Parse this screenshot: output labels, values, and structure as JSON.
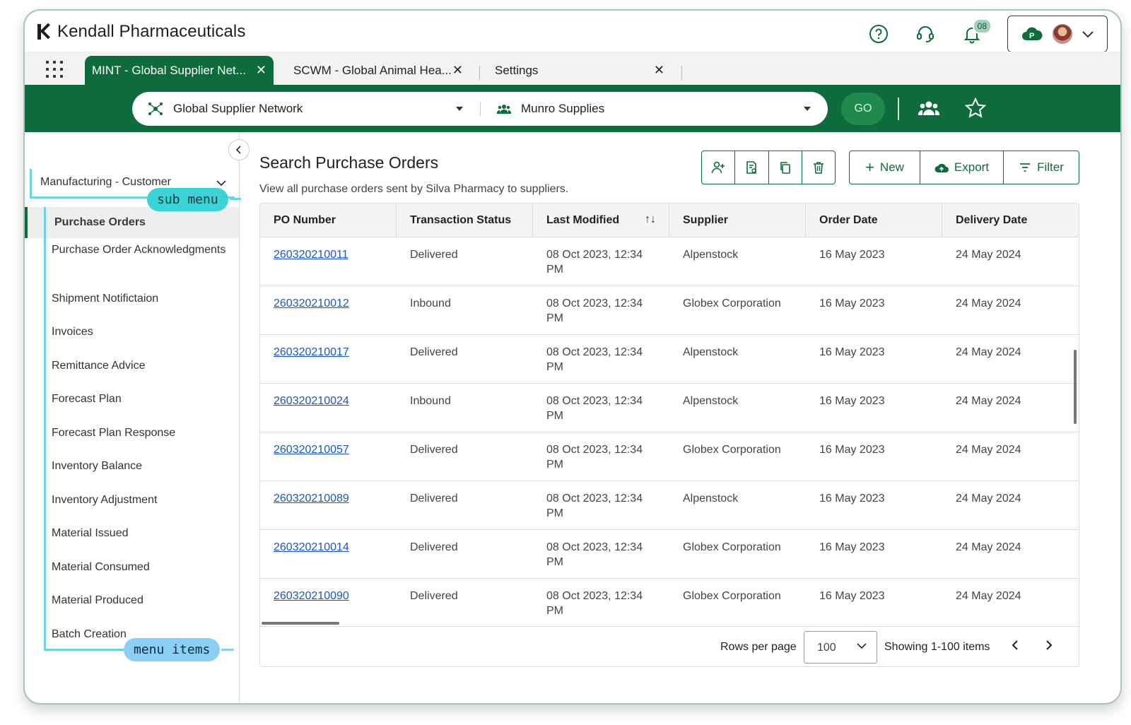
{
  "brand": {
    "name": "Kendall Pharmaceuticals"
  },
  "header": {
    "notification_count": "08",
    "icons": [
      "help-icon",
      "support-headset-icon",
      "bell-icon",
      "cloud-p-icon",
      "avatar",
      "chevron-down-icon"
    ]
  },
  "tabs": [
    {
      "label": "MINT - Global Supplier Net...",
      "active": true
    },
    {
      "label": "SCWM - Global Animal Hea...",
      "active": false
    },
    {
      "label": "Settings",
      "active": false
    }
  ],
  "searchbar": {
    "network": "Global Supplier Network",
    "supplier": "Munro Supplies",
    "go_label": "GO"
  },
  "sidebar": {
    "submenu_label": "Manufacturing - Customer",
    "submenu_tag": "sub menu",
    "items_tag": "menu items",
    "items": [
      "Purchase Orders",
      "Purchase Order Acknowledgments",
      "Shipment Notifictaion",
      "Invoices",
      "Remittance Advice",
      "Forecast Plan",
      "Forecast Plan Response",
      "Inventory Balance",
      "Inventory Adjustment",
      "Material Issued",
      "Material Consumed",
      "Material Produced",
      "Batch Creation"
    ]
  },
  "main": {
    "title": "Search Purchase Orders",
    "subtitle": "View all purchase orders sent by Silva Pharmacy to suppliers.",
    "actions": {
      "new": "New",
      "export": "Export",
      "filter": "Filter"
    }
  },
  "table": {
    "columns": [
      "PO Number",
      "Transaction Status",
      "Last Modified",
      "Supplier",
      "Order Date",
      "Delivery Date"
    ],
    "rows": [
      {
        "po": "260320210011",
        "status": "Delivered",
        "modified_1": "08 Oct 2023, 12:34",
        "modified_2": "PM",
        "supplier": "Alpenstock",
        "order": "16 May 2023",
        "delivery": "24 May 2024"
      },
      {
        "po": "260320210012",
        "status": "Inbound",
        "modified_1": "08 Oct 2023, 12:34",
        "modified_2": "PM",
        "supplier": "Globex Corporation",
        "order": "16 May 2023",
        "delivery": "24 May 2024"
      },
      {
        "po": "260320210017",
        "status": "Delivered",
        "modified_1": "08 Oct 2023, 12:34",
        "modified_2": "PM",
        "supplier": "Alpenstock",
        "order": "16 May 2023",
        "delivery": "24 May 2024"
      },
      {
        "po": "260320210024",
        "status": "Inbound",
        "modified_1": "08 Oct 2023, 12:34",
        "modified_2": "PM",
        "supplier": "Alpenstock",
        "order": "16 May 2023",
        "delivery": "24 May 2024"
      },
      {
        "po": "260320210057",
        "status": "Delivered",
        "modified_1": "08 Oct 2023, 12:34",
        "modified_2": "PM",
        "supplier": "Globex Corporation",
        "order": "16 May 2023",
        "delivery": "24 May 2024"
      },
      {
        "po": "260320210089",
        "status": "Delivered",
        "modified_1": "08 Oct 2023, 12:34",
        "modified_2": "PM",
        "supplier": "Alpenstock",
        "order": "16 May 2023",
        "delivery": "24 May 2024"
      },
      {
        "po": "260320210014",
        "status": "Delivered",
        "modified_1": "08 Oct 2023, 12:34",
        "modified_2": "PM",
        "supplier": "Globex Corporation",
        "order": "16 May 2023",
        "delivery": "24 May 2024"
      },
      {
        "po": "260320210090",
        "status": "Delivered",
        "modified_1": "08 Oct 2023, 12:34",
        "modified_2": "PM",
        "supplier": "Globex Corporation",
        "order": "16 May 2023",
        "delivery": "24 May 2024"
      }
    ]
  },
  "pagination": {
    "rows_per_page_label": "Rows per page",
    "rows_per_page_value": "100",
    "showing": "Showing 1-100 items"
  },
  "colors": {
    "brand_green": "#0e6b3b",
    "link_blue": "#1a56c8",
    "annotation_cyan": "#3bd3d6",
    "annotation_blue": "#8bd0f3"
  }
}
